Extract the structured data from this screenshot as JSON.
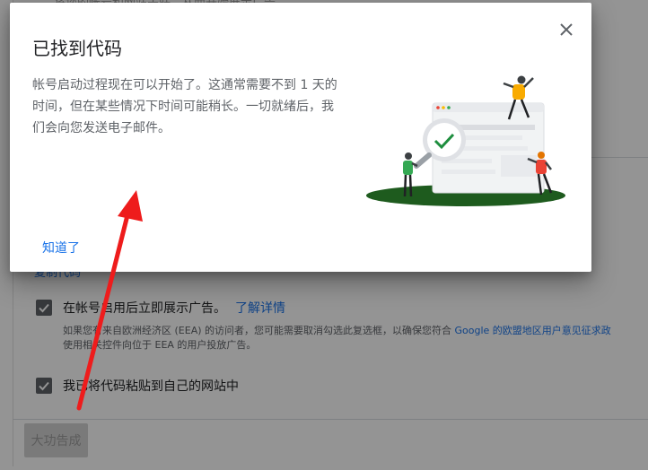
{
  "background": {
    "top_text": "将您的帐号和网站关联，从而开始展示广告",
    "copy_code_link": "复制代码",
    "checkbox_ads": {
      "label": "在帐号启用后立即展示广告。",
      "learn_more": "了解详情",
      "note_line1_a": "如果您有来自欧洲经济区 (EEA) 的访问者，您可能需要取消勾选此复选框，以确保您符合 ",
      "note_line1_link": "Google 的欧盟地区用户意见征求政",
      "note_line2": "使用相关控件向位于 EEA 的用户投放广告。"
    },
    "checkbox_pasted": {
      "label": "我已将代码粘贴到自己的网站中"
    },
    "done_button": "大功告成"
  },
  "dialog": {
    "title": "已找到代码",
    "body_lines": [
      "帐号启动过程现在可以开始了。这通常需要不到 1 天的",
      "时间，但在某些情况下时间可能稍长。一切就绪后，我",
      "们会向您发送电子邮件。"
    ],
    "confirm_button": "知道了",
    "close_icon": "close-icon",
    "illustration_icon": "magnifier-check-illustration"
  },
  "colors": {
    "accent": "#1a73e8",
    "ground": "#1e5b1e",
    "check_green": "#1e8e3e",
    "arrow": "#ee1c1c",
    "person_yellow": "#f9ab00",
    "person_red": "#ea4335"
  }
}
